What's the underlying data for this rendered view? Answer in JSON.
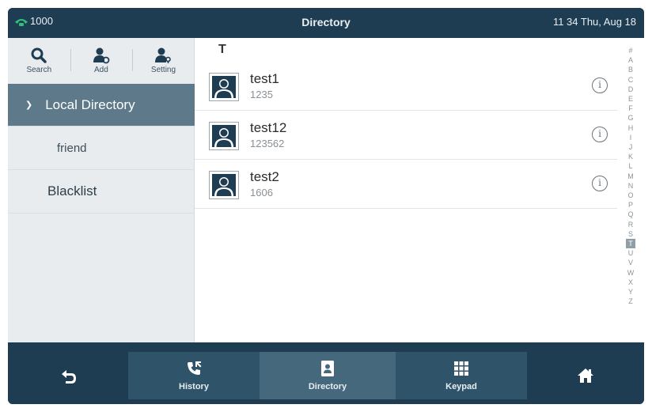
{
  "status": {
    "line": "1000",
    "title": "Directory",
    "datetime": "11 34 Thu, Aug 18"
  },
  "toolbar": {
    "search_label": "Search",
    "add_label": "Add",
    "setting_label": "Setting"
  },
  "sidebar": {
    "items": [
      {
        "label": "Local Directory"
      },
      {
        "label": "friend"
      },
      {
        "label": "Blacklist"
      }
    ]
  },
  "list": {
    "section": "T",
    "contacts": [
      {
        "name": "test1",
        "number": "1235"
      },
      {
        "name": "test12",
        "number": "123562"
      },
      {
        "name": "test2",
        "number": "1606"
      }
    ]
  },
  "index": [
    "#",
    "A",
    "B",
    "C",
    "D",
    "E",
    "F",
    "G",
    "H",
    "I",
    "J",
    "K",
    "L",
    "M",
    "N",
    "O",
    "P",
    "Q",
    "R",
    "S",
    "T",
    "U",
    "V",
    "W",
    "X",
    "Y",
    "Z"
  ],
  "index_active": "T",
  "softkeys": {
    "history": "History",
    "directory": "Directory",
    "keypad": "Keypad"
  },
  "colors": {
    "bar": "#1e3d52",
    "selected": "#5e7a8a",
    "line_icon": "#2fc07a"
  }
}
